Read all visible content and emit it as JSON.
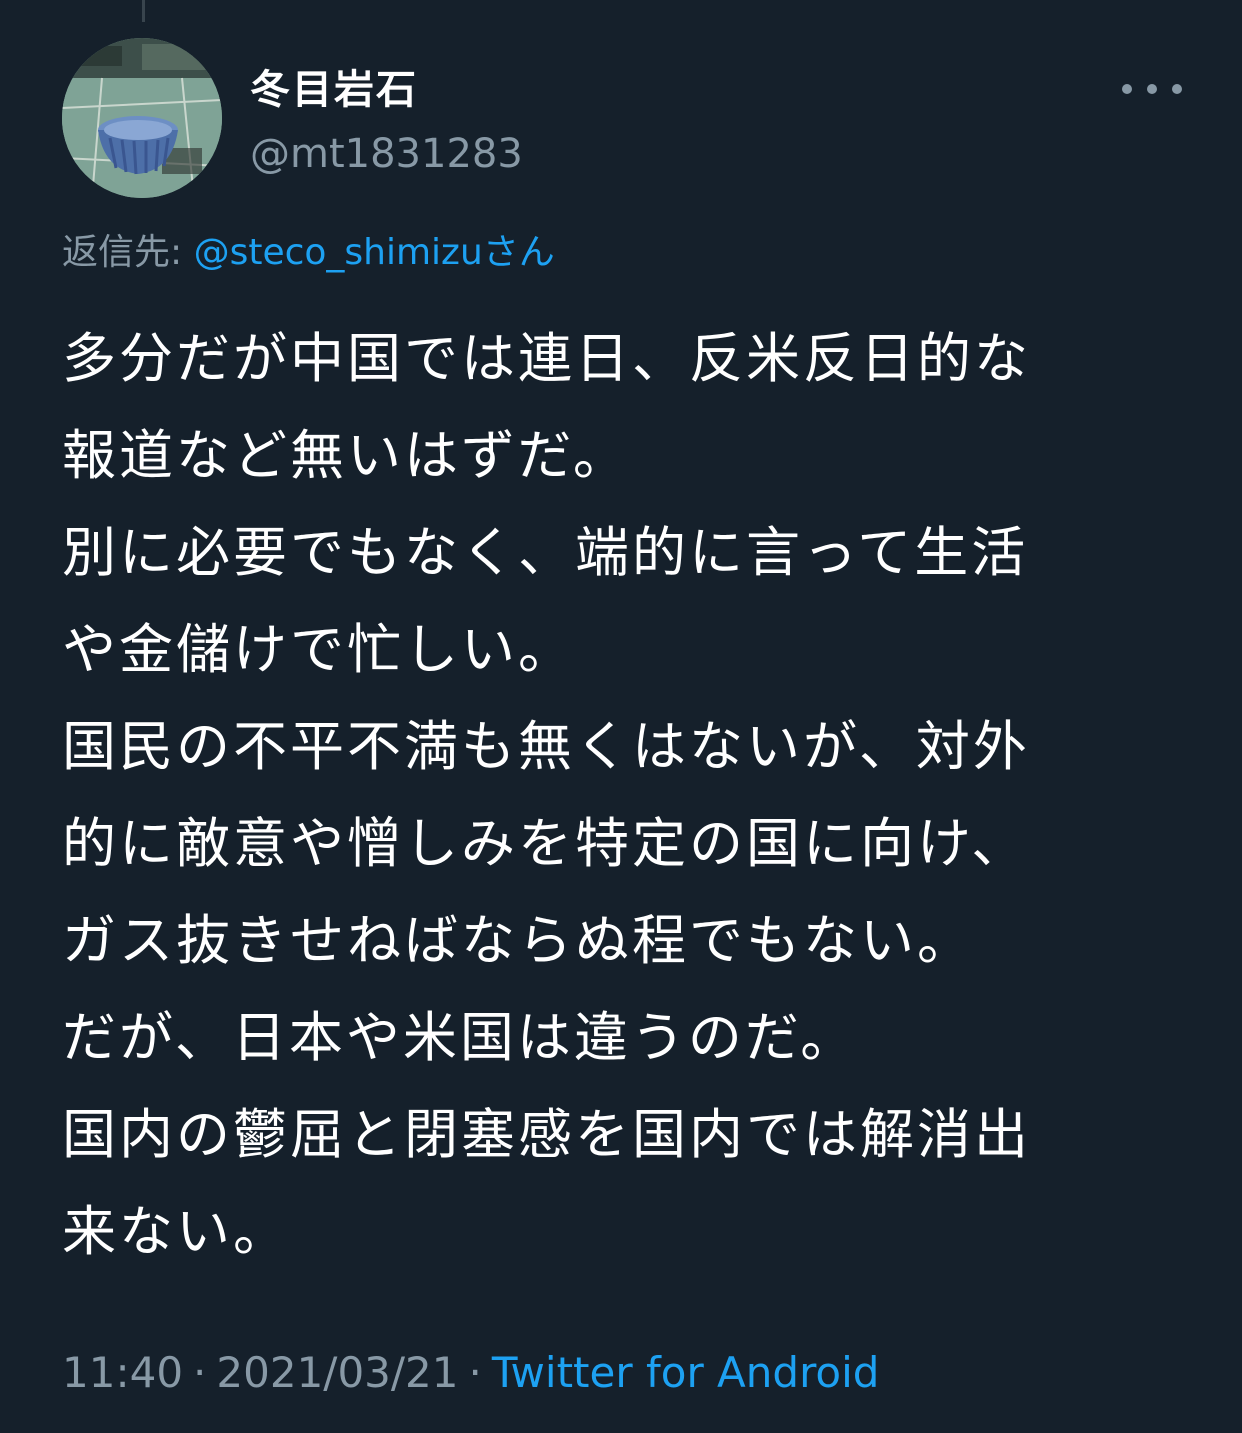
{
  "tweet": {
    "display_name": "冬目岩石",
    "handle": "@mt1831283",
    "reply_label": "返信先: ",
    "reply_mention": "@steco_shimizuさん",
    "text_lines": [
      "多分だが中国では連日、反米反日的な",
      "報道など無いはずだ。",
      "別に必要でもなく、端的に言って生活",
      "や金儲けで忙しい。",
      "国民の不平不満も無くはないが、対外",
      "的に敵意や憎しみを特定の国に向け、",
      "ガス抜きせねばならぬ程でもない。",
      "だが、日本や米国は違うのだ。",
      "国内の鬱屈と閉塞感を国内では解消出",
      "来ない。"
    ],
    "time": "11:40",
    "separator": "·",
    "date": "2021/03/21",
    "source": "Twitter for Android"
  },
  "icons": {
    "more": "more-horizontal-icon",
    "avatar": "avatar-bowl-photo"
  },
  "colors": {
    "background": "#15202b",
    "text": "#ffffff",
    "secondary": "#8899a6",
    "link": "#1da1f2"
  }
}
